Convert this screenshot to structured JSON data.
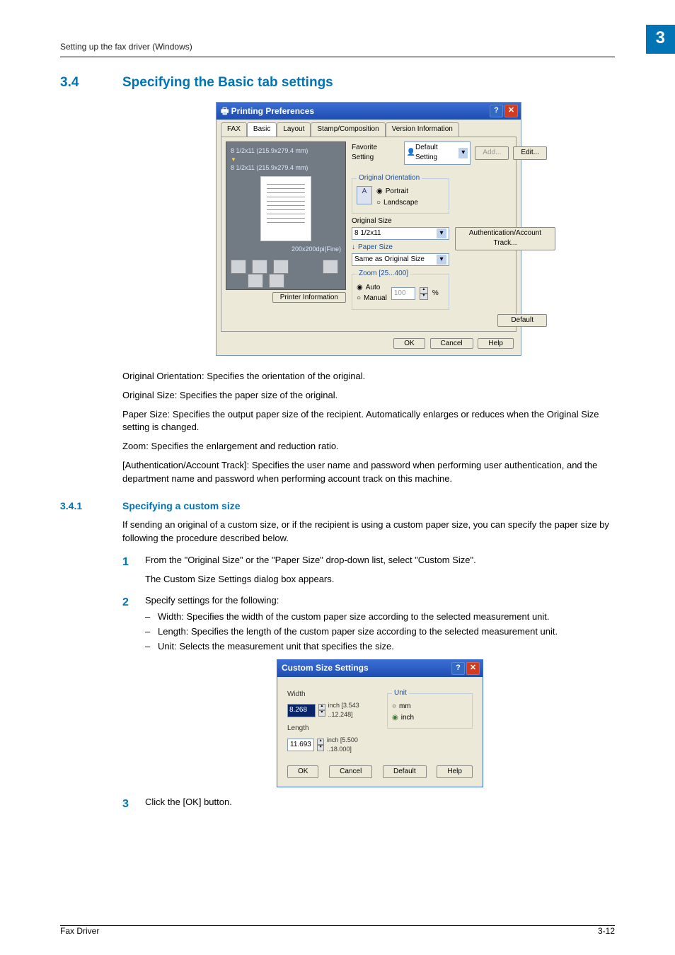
{
  "header": {
    "breadcrumb": "Setting up the fax driver (Windows)",
    "chapter_num": "3"
  },
  "section": {
    "num": "3.4",
    "title": "Specifying the Basic tab settings"
  },
  "dlg1": {
    "title": "Printing Preferences",
    "tabs": [
      "FAX",
      "Basic",
      "Layout",
      "Stamp/Composition",
      "Version Information"
    ],
    "preview_top1": "8 1/2x11 (215.9x279.4 mm)",
    "preview_top2": "8 1/2x11 (215.9x279.4 mm)",
    "dpi": "200x200dpi(Fine)",
    "printer_info_btn": "Printer Information",
    "fav_label": "Favorite Setting",
    "fav_value": "Default Setting",
    "add_btn": "Add...",
    "edit_btn": "Edit...",
    "orientation_legend": "Original Orientation",
    "portrait": "Portrait",
    "landscape": "Landscape",
    "orig_size_lbl": "Original Size",
    "orig_size_val": "8 1/2x11",
    "paper_size_lbl": "Paper Size",
    "paper_size_val": "Same as Original Size",
    "zoom_legend": "Zoom [25...400]",
    "zoom_auto": "Auto",
    "zoom_manual": "Manual",
    "zoom_val": "100",
    "zoom_pct": "%",
    "auth_btn": "Authentication/Account Track...",
    "default_btn": "Default",
    "ok": "OK",
    "cancel": "Cancel",
    "help": "Help"
  },
  "para": {
    "p1": "Original Orientation: Specifies the orientation of the original.",
    "p2": "Original Size: Specifies the paper size of the original.",
    "p3": "Paper Size: Specifies the output paper size of the recipient. Automatically enlarges or reduces when the Original Size setting is changed.",
    "p4": "Zoom: Specifies the enlargement and reduction ratio.",
    "p5": "[Authentication/Account Track]: Specifies the user name and password when performing user authentication, and the department name and password when performing account track on this machine."
  },
  "subsection": {
    "num": "3.4.1",
    "title": "Specifying a custom size",
    "intro": "If sending an original of a custom size, or if the recipient is using a custom paper size, you can specify the paper size by following the procedure described below."
  },
  "steps": {
    "s1a": "From the \"Original Size\" or the \"Paper Size\" drop-down list, select \"Custom Size\".",
    "s1b": "The Custom Size Settings dialog box appears.",
    "s2": "Specify settings for the following:",
    "b1": "Width: Specifies the width of the custom paper size according to the selected measurement unit.",
    "b2": "Length: Specifies the length of the custom paper size according to the selected measurement unit.",
    "b3": "Unit: Selects the measurement unit that specifies the size.",
    "s3": "Click the [OK] button."
  },
  "dlg2": {
    "title": "Custom Size Settings",
    "width_lbl": "Width",
    "width_val": "8.268",
    "width_range": "inch [3.543 ..12.248]",
    "length_lbl": "Length",
    "length_val": "11.693",
    "length_range": "inch [5.500 ..18.000]",
    "unit_legend": "Unit",
    "unit_mm": "mm",
    "unit_inch": "inch",
    "ok": "OK",
    "cancel": "Cancel",
    "default": "Default",
    "help": "Help"
  },
  "footer": {
    "left": "Fax Driver",
    "right": "3-12"
  }
}
